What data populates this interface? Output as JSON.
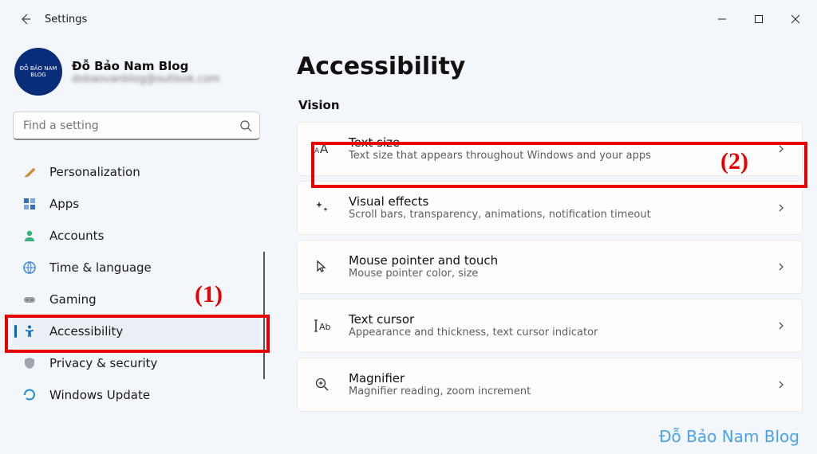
{
  "window": {
    "title": "Settings"
  },
  "profile": {
    "name": "Đỗ Bảo Nam Blog",
    "email": "dobaovanblog@outlook.com",
    "avatar_text": "ĐỖ BẢO NAM BLOG"
  },
  "search": {
    "placeholder": "Find a setting"
  },
  "sidebar": {
    "items": [
      {
        "label": "Personalization"
      },
      {
        "label": "Apps"
      },
      {
        "label": "Accounts"
      },
      {
        "label": "Time & language"
      },
      {
        "label": "Gaming"
      },
      {
        "label": "Accessibility"
      },
      {
        "label": "Privacy & security"
      },
      {
        "label": "Windows Update"
      }
    ]
  },
  "page": {
    "title": "Accessibility",
    "section": "Vision",
    "cards": [
      {
        "title": "Text size",
        "sub": "Text size that appears throughout Windows and your apps"
      },
      {
        "title": "Visual effects",
        "sub": "Scroll bars, transparency, animations, notification timeout"
      },
      {
        "title": "Mouse pointer and touch",
        "sub": "Mouse pointer color, size"
      },
      {
        "title": "Text cursor",
        "sub": "Appearance and thickness, text cursor indicator"
      },
      {
        "title": "Magnifier",
        "sub": "Magnifier reading, zoom increment"
      }
    ]
  },
  "annotations": {
    "one": "(1)",
    "two": "(2)"
  },
  "watermark": "Đỗ Bảo Nam Blog"
}
